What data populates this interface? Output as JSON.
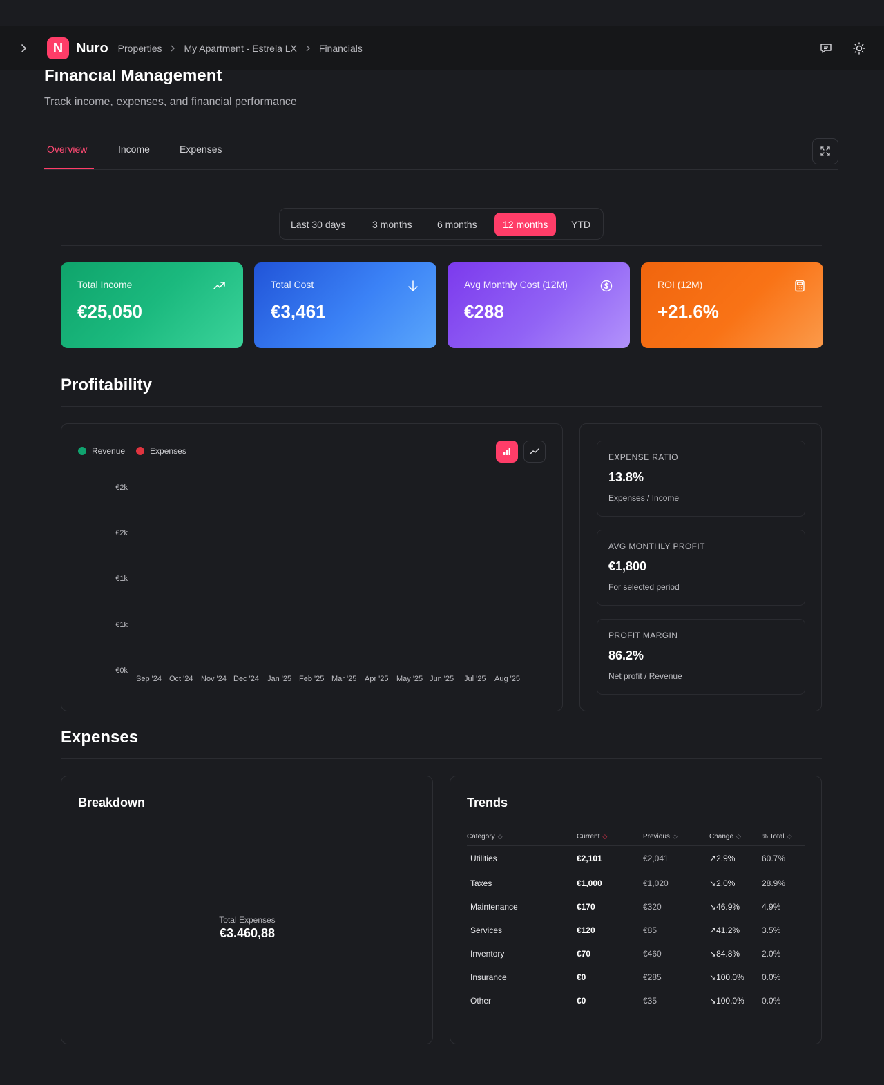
{
  "header": {
    "brand": "Nuro",
    "logo_letter": "N",
    "breadcrumbs": [
      "Properties",
      "My Apartment - Estrela LX",
      "Financials"
    ]
  },
  "page": {
    "title": "Financial Management",
    "subtitle": "Track income, expenses, and financial performance"
  },
  "tabs": [
    {
      "label": "Overview",
      "active": true
    },
    {
      "label": "Income",
      "active": false
    },
    {
      "label": "Expenses",
      "active": false
    }
  ],
  "range": {
    "options": [
      "Last 30 days",
      "3 months",
      "6 months",
      "12 months",
      "YTD"
    ],
    "selected": "12 months"
  },
  "cards": [
    {
      "label": "Total Income",
      "value": "€25,050",
      "icon": "trending-up-icon",
      "color": "#10b981"
    },
    {
      "label": "Total Cost",
      "value": "€3,461",
      "icon": "arrow-down-icon",
      "color": "#3b82f6"
    },
    {
      "label": "Avg Monthly Cost (12M)",
      "value": "€288",
      "icon": "dollar-circle-icon",
      "color": "#8b5cf6"
    },
    {
      "label": "ROI (12M)",
      "value": "+21.6%",
      "icon": "calculator-icon",
      "color": "#f97316"
    }
  ],
  "profitability": {
    "title": "Profitability",
    "legend": [
      {
        "label": "Revenue",
        "color": "#10a36f"
      },
      {
        "label": "Expenses",
        "color": "#e0343f"
      }
    ],
    "chart_data": {
      "type": "bar",
      "categories": [
        "Sep '24",
        "Oct '24",
        "Nov '24",
        "Dec '24",
        "Jan '25",
        "Feb '25",
        "Mar '25",
        "Apr '25",
        "May '25",
        "Jun '25",
        "Jul '25",
        "Aug '25"
      ],
      "y_ticks": [
        "€2k",
        "€2k",
        "€1k",
        "€1k",
        "€0k"
      ],
      "series": [
        {
          "name": "Revenue",
          "values": []
        },
        {
          "name": "Expenses",
          "values": []
        }
      ],
      "grid": false
    },
    "metrics": [
      {
        "label": "EXPENSE RATIO",
        "value": "13.8%",
        "sub": "Expenses / Income"
      },
      {
        "label": "AVG MONTHLY PROFIT",
        "value": "€1,800",
        "sub": "For selected period"
      },
      {
        "label": "PROFIT MARGIN",
        "value": "86.2%",
        "sub": "Net profit / Revenue"
      }
    ]
  },
  "expenses": {
    "title": "Expenses",
    "breakdown": {
      "title": "Breakdown",
      "center_label": "Total Expenses",
      "center_value": "€3.460,88"
    },
    "trends": {
      "title": "Trends",
      "columns": [
        "Category",
        "Current",
        "Previous",
        "Change",
        "% Total"
      ],
      "rows": [
        {
          "category": "Utilities",
          "current": "€2,101",
          "previous": "€2,041",
          "change": "2.9%",
          "direction": "up",
          "pct": "60.7%"
        },
        {
          "category": "Taxes",
          "current": "€1,000",
          "previous": "€1,020",
          "change": "2.0%",
          "direction": "down",
          "pct": "28.9%"
        },
        {
          "category": "Maintenance",
          "current": "€170",
          "previous": "€320",
          "change": "46.9%",
          "direction": "down",
          "pct": "4.9%"
        },
        {
          "category": "Services",
          "current": "€120",
          "previous": "€85",
          "change": "41.2%",
          "direction": "up",
          "pct": "3.5%"
        },
        {
          "category": "Inventory",
          "current": "€70",
          "previous": "€460",
          "change": "84.8%",
          "direction": "down",
          "pct": "2.0%"
        },
        {
          "category": "Insurance",
          "current": "€0",
          "previous": "€285",
          "change": "100.0%",
          "direction": "down",
          "pct": "0.0%"
        },
        {
          "category": "Other",
          "current": "€0",
          "previous": "€35",
          "change": "100.0%",
          "direction": "down",
          "pct": "0.0%"
        }
      ]
    }
  }
}
